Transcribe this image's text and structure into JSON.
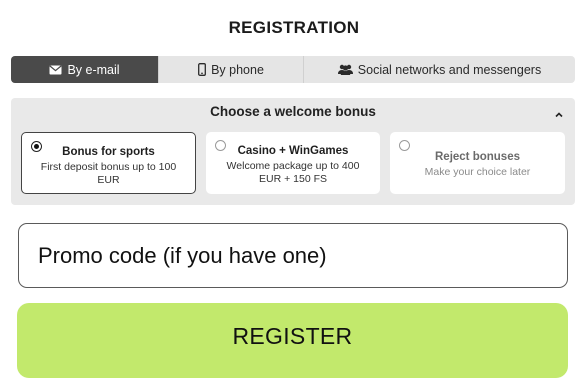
{
  "header": {
    "title": "REGISTRATION"
  },
  "tabs": [
    {
      "label": "By e-mail",
      "icon": "envelope-icon",
      "active": true
    },
    {
      "label": "By phone",
      "icon": "phone-icon",
      "active": false
    },
    {
      "label": "Social networks and messengers",
      "icon": "users-icon",
      "active": false
    }
  ],
  "bonus": {
    "heading": "Choose a welcome bonus",
    "options": [
      {
        "title": "Bonus for sports",
        "desc_line1": "First deposit bonus up to 100",
        "desc_line2": "EUR",
        "selected": true
      },
      {
        "title": "Casino + WinGames",
        "desc_line1": "Welcome package up to 400",
        "desc_line2": "EUR + 150 FS",
        "selected": false
      },
      {
        "title": "Reject bonuses",
        "desc_line1": "Make your choice later",
        "selected": false
      }
    ]
  },
  "promo": {
    "placeholder": "Promo code (if you have one)",
    "value": ""
  },
  "register": {
    "label": "REGISTER"
  },
  "colors": {
    "accent": "#c2e96c",
    "tab_active": "#4a4a4a",
    "panel": "#e9e9e9"
  }
}
